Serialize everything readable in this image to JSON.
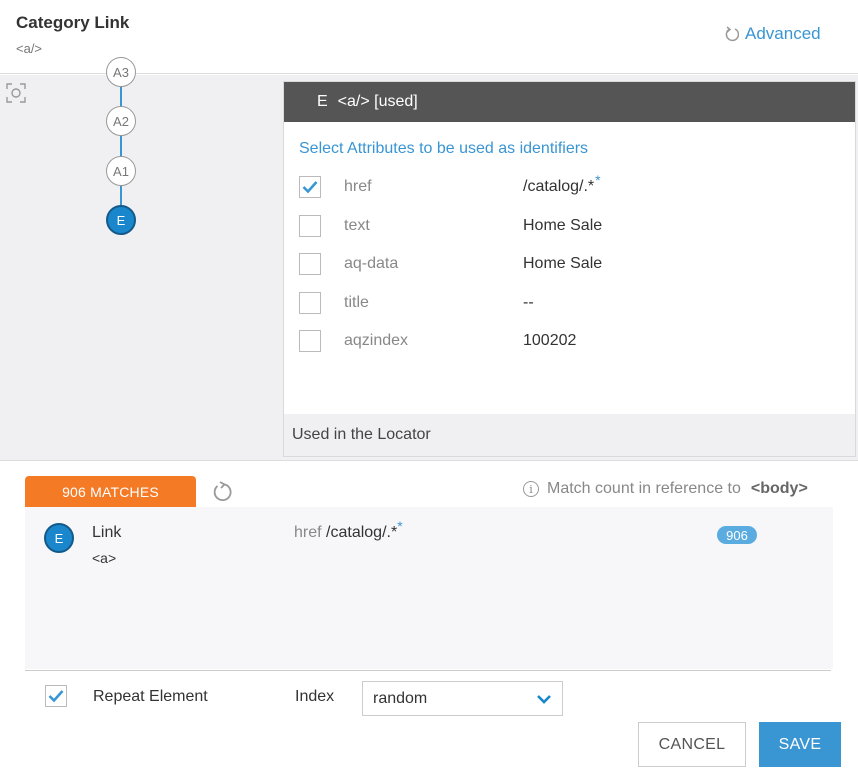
{
  "header": {
    "title": "Category Link",
    "subtitle": "<a/>",
    "advanced_label": "Advanced"
  },
  "tree": {
    "nodes": [
      "A3",
      "A2",
      "A1",
      "E"
    ]
  },
  "panel": {
    "head_letter": "E",
    "head_label": "<a/> [used]",
    "section_title": "Select Attributes to be used as identifiers",
    "attributes": [
      {
        "name": "href",
        "value": "/catalog/.*",
        "star": "*",
        "checked": true
      },
      {
        "name": "text",
        "value": "Home Sale",
        "star": "",
        "checked": false
      },
      {
        "name": "aq-data",
        "value": "Home Sale",
        "star": "",
        "checked": false
      },
      {
        "name": "title",
        "value": "--",
        "star": "",
        "checked": false
      },
      {
        "name": "aqzindex",
        "value": "100202",
        "star": "",
        "checked": false
      }
    ],
    "footer": "Used in the Locator"
  },
  "matches": {
    "tab_label": "906 MATCHES",
    "reference_note": "Match count in reference to",
    "reference_tag": "<body>",
    "row": {
      "letter": "E",
      "name": "Link",
      "tag": "<a>",
      "attr_name": "href",
      "attr_value": "/catalog/.*",
      "attr_star": "*",
      "count": "906"
    }
  },
  "footer": {
    "repeat_label": "Repeat Element",
    "repeat_checked": true,
    "index_label": "Index",
    "index_value": "random",
    "cancel_label": "CANCEL",
    "save_label": "SAVE"
  },
  "colors": {
    "accent": "#3a95d3",
    "matches_tab": "#f47a25",
    "panel_header": "#555555"
  }
}
